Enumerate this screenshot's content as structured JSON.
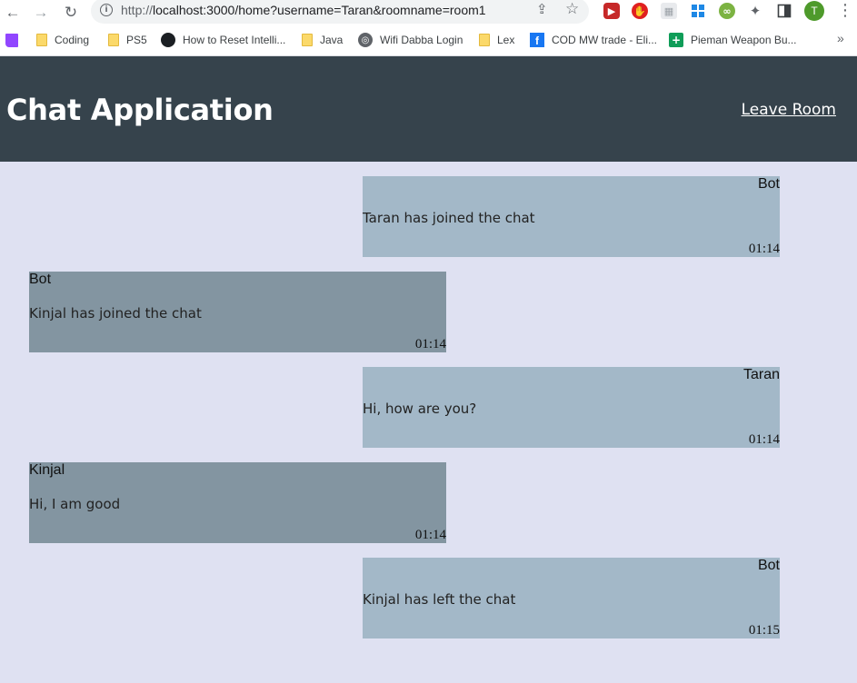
{
  "browser": {
    "url_scheme": "http://",
    "url_rest": "localhost:3000/home?username=Taran&roomname=room1",
    "profile_initial": "T",
    "bookmarks": [
      {
        "label": "Coding",
        "icon": "folder-icon"
      },
      {
        "label": "PS5",
        "icon": "folder-icon"
      },
      {
        "label": "How to Reset Intelli...",
        "icon": "github-icon"
      },
      {
        "label": "Java",
        "icon": "folder-icon"
      },
      {
        "label": "Wifi Dabba Login",
        "icon": "globe-icon"
      },
      {
        "label": "Lex",
        "icon": "folder-icon"
      },
      {
        "label": "COD MW trade - Eli...",
        "icon": "facebook-icon"
      },
      {
        "label": "Pieman Weapon Bu...",
        "icon": "sheets-icon"
      }
    ],
    "more_bookmarks": "»"
  },
  "header": {
    "title": "Chat Application",
    "leave_label": "Leave Room"
  },
  "messages": [
    {
      "author": "Bot",
      "text": "Taran has joined the chat",
      "time": "01:14",
      "side": "right"
    },
    {
      "author": "Bot",
      "text": "Kinjal has joined the chat",
      "time": "01:14",
      "side": "left"
    },
    {
      "author": "Taran",
      "text": "Hi, how are you?",
      "time": "01:14",
      "side": "right"
    },
    {
      "author": "Kinjal",
      "text": "Hi, I am good",
      "time": "01:14",
      "side": "left"
    },
    {
      "author": "Bot",
      "text": "Kinjal has left the chat",
      "time": "01:15",
      "side": "right"
    }
  ],
  "colors": {
    "header_bg": "#36434c",
    "page_bg": "#dfe1f2",
    "own_message_bg": "#a3b8c8",
    "other_message_bg": "#8395a1"
  }
}
